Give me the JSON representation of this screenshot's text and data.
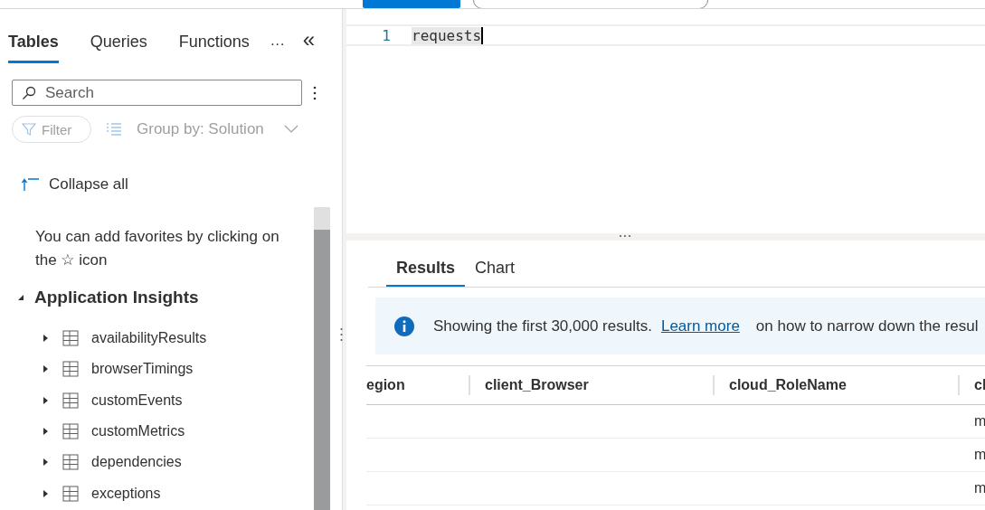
{
  "sidebar": {
    "tabs": [
      {
        "label": "Tables",
        "selected": true
      },
      {
        "label": "Queries",
        "selected": false
      },
      {
        "label": "Functions",
        "selected": false
      }
    ],
    "more": "···",
    "collapse_panel": "«",
    "search": {
      "placeholder": "Search"
    },
    "filter": {
      "label": "Filter",
      "disabled": true
    },
    "group_by": {
      "label": "Group by: Solution",
      "disabled": true
    },
    "collapse_all": "Collapse all",
    "favorites_hint": "You can add favorites by clicking on the ☆ icon",
    "tree": [
      {
        "label": "Application Insights",
        "expanded": true,
        "children": [
          {
            "label": "availabilityResults",
            "expanded": false
          },
          {
            "label": "browserTimings",
            "expanded": false
          },
          {
            "label": "customEvents",
            "expanded": false
          },
          {
            "label": "customMetrics",
            "expanded": false
          },
          {
            "label": "dependencies",
            "expanded": false
          },
          {
            "label": "exceptions",
            "expanded": false
          }
        ]
      }
    ]
  },
  "editor": {
    "lines": [
      {
        "number": "1",
        "text": "requests"
      }
    ]
  },
  "results": {
    "tabs": [
      {
        "label": "Results",
        "selected": true
      },
      {
        "label": "Chart",
        "selected": false
      }
    ],
    "banner": {
      "text": "Showing the first 30,000 results.",
      "link": "Learn more",
      "tail": "on how to narrow down the resul"
    },
    "table": {
      "columns": [
        "egion",
        "client_Browser",
        "cloud_RoleName",
        "cl"
      ],
      "rows": [
        [
          "",
          "",
          "",
          "m"
        ],
        [
          "",
          "",
          "",
          "m"
        ],
        [
          "",
          "",
          "",
          "m"
        ]
      ]
    }
  }
}
